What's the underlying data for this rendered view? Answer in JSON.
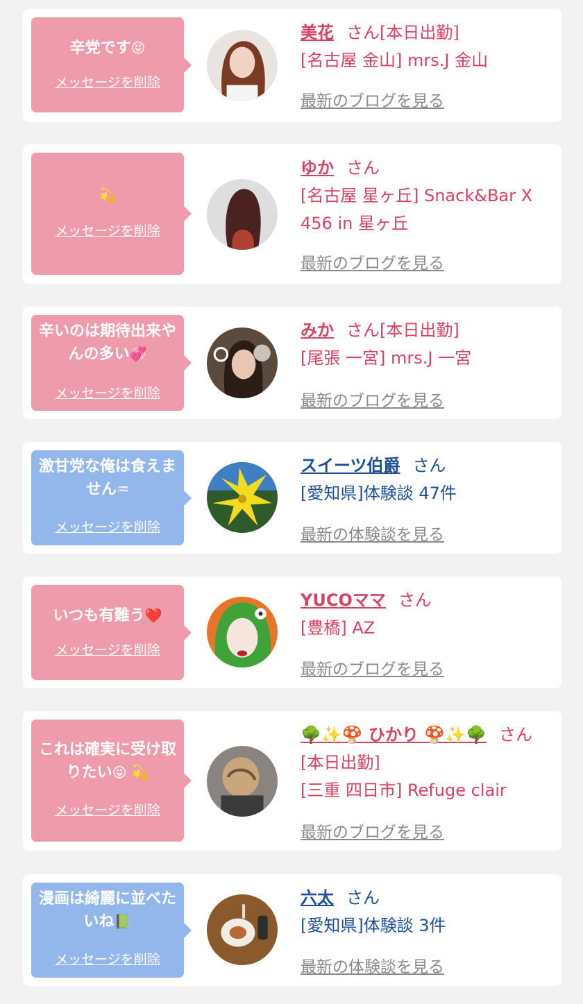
{
  "delete_label": "メッセージを削除",
  "san_label": "さん",
  "colors": {
    "pink_bubble": "#ee9bab",
    "blue_bubble": "#93b7ea",
    "pink_text": "#d9415f",
    "blue_text": "#1d4f96"
  },
  "cards": [
    {
      "bubble_color": "pink",
      "message": "辛党です",
      "message_emoji": "😝",
      "name": "美花",
      "suffix": "[本日出勤]",
      "shop": "[名古屋 金山] mrs.J 金山",
      "link": "最新のブログを見る"
    },
    {
      "bubble_color": "pink",
      "message": "",
      "message_emoji": "💫",
      "name": "ゆか",
      "suffix": "",
      "shop": "[名古屋 星ヶ丘] Snack&Bar X 456 in 星ヶ丘",
      "link": "最新のブログを見る"
    },
    {
      "bubble_color": "pink",
      "message": "辛いのは期待出来やんの多い",
      "message_emoji": "💞",
      "name": "みか",
      "suffix": "[本日出勤]",
      "shop": "[尾張 一宮] mrs.J 一宮",
      "link": "最新のブログを見る"
    },
    {
      "bubble_color": "blue",
      "message": "激甘党な俺は食えません",
      "message_emoji": "♒",
      "name": "スイーツ伯爵",
      "suffix": "",
      "shop": "[愛知県]体験談 47件",
      "link": "最新の体験談を見る"
    },
    {
      "bubble_color": "pink",
      "message": "いつも有難う",
      "message_emoji": "❤️",
      "name": "YUCOママ",
      "suffix": "",
      "shop": "[豊橋] AZ",
      "link": "最新のブログを見る"
    },
    {
      "bubble_color": "pink",
      "message": "これは確実に受け取りたい",
      "message_emoji": "😝 💫",
      "name": "🌳✨🍄 ひかり 🍄✨🌳",
      "suffix": "[本日出勤]",
      "shop": "[三重 四日市] Refuge clair",
      "link": "最新のブログを見る"
    },
    {
      "bubble_color": "blue",
      "message": "漫画は綺麗に並べたいね",
      "message_emoji": "📗",
      "name": "六太",
      "suffix": "",
      "shop": "[愛知県]体験談 3件",
      "link": "最新の体験談を見る"
    }
  ]
}
